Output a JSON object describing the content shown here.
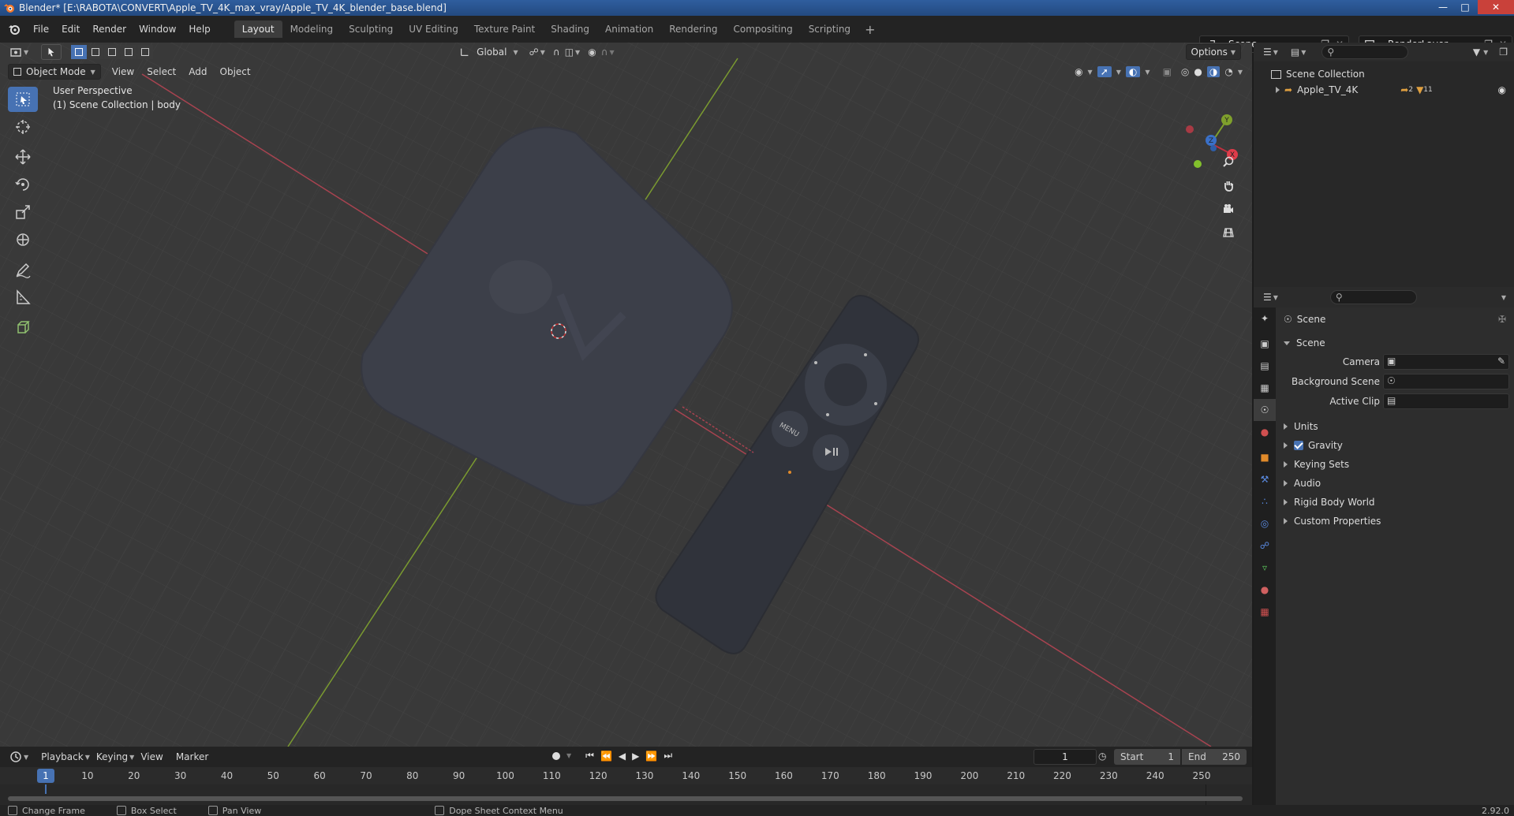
{
  "window": {
    "title": "Blender* [E:\\RABOTA\\CONVERT\\Apple_TV_4K_max_vray/Apple_TV_4K_blender_base.blend]"
  },
  "menubar": {
    "items": [
      "File",
      "Edit",
      "Render",
      "Window",
      "Help"
    ]
  },
  "workspaces": {
    "tabs": [
      "Layout",
      "Modeling",
      "Sculpting",
      "UV Editing",
      "Texture Paint",
      "Shading",
      "Animation",
      "Rendering",
      "Compositing",
      "Scripting"
    ],
    "active": "Layout"
  },
  "scene_selector": {
    "value": "Scene"
  },
  "renderlayer_selector": {
    "value": "RenderLayer"
  },
  "viewport": {
    "orientation": "Global",
    "options_label": "Options",
    "mode": "Object Mode",
    "menu": [
      "View",
      "Select",
      "Add",
      "Object"
    ],
    "overlay_line1": "User Perspective",
    "overlay_line2": "(1) Scene Collection | body",
    "remote_menu_label": "MENU",
    "grid_color": "#393939",
    "x_axis_color": "#c0404a",
    "y_axis_color": "#7aa22c",
    "active_tool_color": "#4772b3"
  },
  "timeline": {
    "menu": [
      "Playback",
      "Keying",
      "View",
      "Marker"
    ],
    "current_frame": "1",
    "start_label": "Start",
    "start_value": "1",
    "end_label": "End",
    "end_value": "250",
    "ticks": [
      "1",
      "10",
      "20",
      "30",
      "40",
      "50",
      "60",
      "70",
      "80",
      "90",
      "100",
      "110",
      "120",
      "130",
      "140",
      "150",
      "160",
      "170",
      "180",
      "190",
      "200",
      "210",
      "220",
      "230",
      "240",
      "250"
    ]
  },
  "statusbar": {
    "items": [
      "Change Frame",
      "Box Select",
      "Pan View",
      "Dope Sheet Context Menu"
    ],
    "version": "2.92.0"
  },
  "outliner": {
    "root": "Scene Collection",
    "items": [
      {
        "label": "Apple_TV_4K",
        "sub1": "2",
        "sub2": "11"
      }
    ]
  },
  "properties": {
    "header_title": "Scene",
    "panel_title": "Scene",
    "fields": [
      {
        "label": "Camera"
      },
      {
        "label": "Background Scene"
      },
      {
        "label": "Active Clip"
      }
    ],
    "panels": [
      "Units",
      "Gravity",
      "Keying Sets",
      "Audio",
      "Rigid Body World",
      "Custom Properties"
    ]
  }
}
